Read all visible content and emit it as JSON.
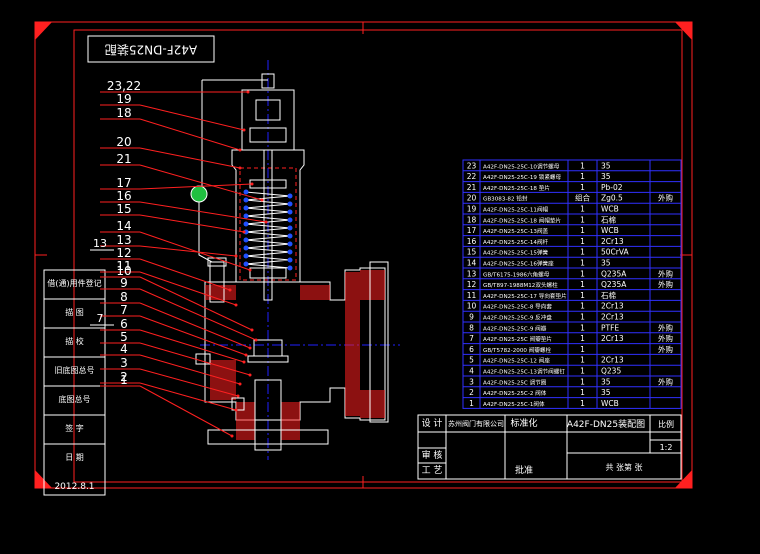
{
  "drawing": {
    "title_box_text": "A42F-DN25装配",
    "left_labels": [
      "借(通)用件登记",
      "描 图",
      "描 校",
      "旧底图总号",
      "底图总号",
      "签 字",
      "日 期"
    ],
    "date": "2012.8.1",
    "leader_numbers": [
      "23,22",
      "19",
      "18",
      "20",
      "21",
      "17",
      "16",
      "15",
      "14",
      "13",
      "12",
      "11",
      "10",
      "9",
      "8",
      "7",
      "6",
      "5",
      "4",
      "3",
      "2",
      "1"
    ],
    "side_numbers": [
      "13",
      "7"
    ],
    "colors": {
      "frame": "#ff2020",
      "leader": "#ff2020",
      "outline": "#ffffff",
      "hatch": "#ff2020",
      "table_line": "#2020ff",
      "text": "#ffffff",
      "part_text": "#ffff40"
    }
  },
  "bom": {
    "rows": [
      {
        "no": "23",
        "name": "A42F-DN25-25C-10调节螺母",
        "qty": "1",
        "mat": "35",
        "mark": ""
      },
      {
        "no": "22",
        "name": "A42F-DN25-25C-19 锁紧螺母",
        "qty": "1",
        "mat": "35",
        "mark": ""
      },
      {
        "no": "21",
        "name": "A42F-DN25-25C-18 垫片",
        "qty": "1",
        "mat": "Pb-02",
        "mark": ""
      },
      {
        "no": "20",
        "name": "GB3083-82 铅封",
        "qty": "组合",
        "mat": "Zg0.5",
        "mark": "外购"
      },
      {
        "no": "19",
        "name": "A42F-DN25-25C-11阀帽",
        "qty": "1",
        "mat": "WCB",
        "mark": ""
      },
      {
        "no": "18",
        "name": "A42F-DN25-25C-18 阀帽垫片",
        "qty": "1",
        "mat": "石棉",
        "mark": ""
      },
      {
        "no": "17",
        "name": "A42F-DN25-25C-13阀盖",
        "qty": "1",
        "mat": "WCB",
        "mark": ""
      },
      {
        "no": "16",
        "name": "A42F-DN25-25C-14阀杆",
        "qty": "1",
        "mat": "2Cr13",
        "mark": ""
      },
      {
        "no": "15",
        "name": "A42F-DN25-25C-15弹簧",
        "qty": "1",
        "mat": "50CrVA",
        "mark": ""
      },
      {
        "no": "14",
        "name": "A42F-DN25-25C-16弹簧座",
        "qty": "1",
        "mat": "35",
        "mark": ""
      },
      {
        "no": "13",
        "name": "GB/T6175-1986六角螺母",
        "qty": "1",
        "mat": "Q235A",
        "mark": "外购"
      },
      {
        "no": "12",
        "name": "GB/T897-1988M12双头螺柱",
        "qty": "1",
        "mat": "Q235A",
        "mark": "外购"
      },
      {
        "no": "11",
        "name": "A42F-DN25-25C-17 导向套垫片",
        "qty": "1",
        "mat": "石棉",
        "mark": ""
      },
      {
        "no": "10",
        "name": "A42F-DN25-25C-8 导向套",
        "qty": "1",
        "mat": "2Cr13",
        "mark": ""
      },
      {
        "no": "9",
        "name": "A42F-DN25-25C-9 反冲盘",
        "qty": "1",
        "mat": "2Cr13",
        "mark": ""
      },
      {
        "no": "8",
        "name": "A42F-DN25-25C-9 阀瓣",
        "qty": "1",
        "mat": "PTFE",
        "mark": "外购"
      },
      {
        "no": "7",
        "name": "A42F-DN25-25C 阀瓣垫片",
        "qty": "1",
        "mat": "2Cr13",
        "mark": "外购"
      },
      {
        "no": "6",
        "name": "GB/T5782-2000 阀瓣螺栓",
        "qty": "1",
        "mat": "",
        "mark": "外购"
      },
      {
        "no": "5",
        "name": "A42F-DN25-25C-12 阀座",
        "qty": "1",
        "mat": "2Cr13",
        "mark": ""
      },
      {
        "no": "4",
        "name": "A42F-DN25-25C-13调节阀螺钉",
        "qty": "1",
        "mat": "Q235",
        "mark": ""
      },
      {
        "no": "3",
        "name": "A42F-DN25-25C 调节圈",
        "qty": "1",
        "mat": "35",
        "mark": "外购"
      },
      {
        "no": "2",
        "name": "A42F-DN25-25C-2 阀体",
        "qty": "1",
        "mat": "35",
        "mark": ""
      },
      {
        "no": "1",
        "name": "A42F-DN25-25C-1阀体",
        "qty": "1",
        "mat": "WCB",
        "mark": ""
      }
    ]
  },
  "title_block": {
    "design_label": "设 计",
    "company": "苏州阀门有限公司",
    "standard_label": "标准化",
    "drawing_name": "A42F-DN25装配图",
    "scale_label": "比例",
    "scale_value": "1:2",
    "review_label": "审 核",
    "process_label": "工 艺",
    "approve_label": "批准",
    "sheets_total_label": "共  张第  张"
  }
}
